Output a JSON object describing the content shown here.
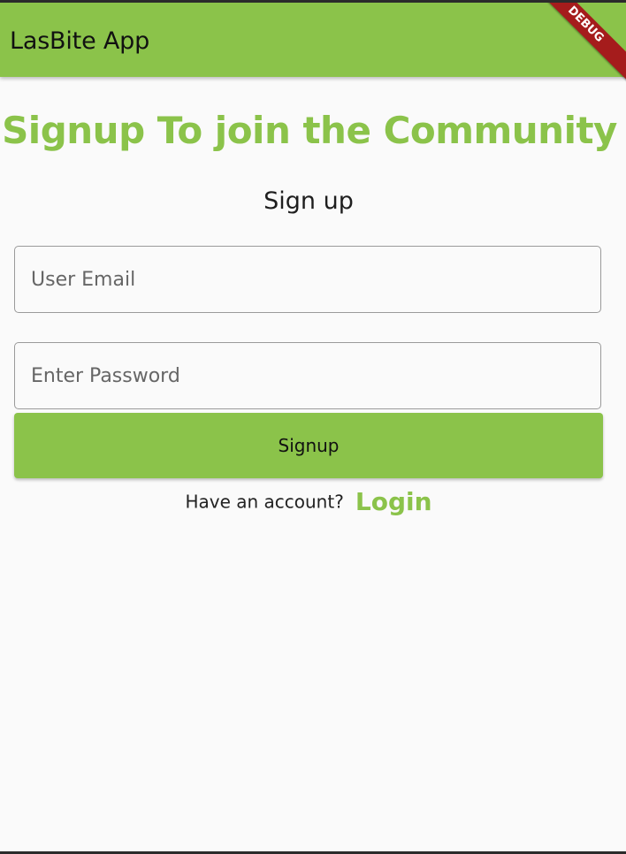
{
  "appbar": {
    "title": "LasBite App",
    "debug_label": "DEBUG",
    "color": "#8bc34a"
  },
  "form": {
    "heading": "Signup To join the Community",
    "subheading": "Sign up",
    "email": {
      "value": "",
      "placeholder": "User Email"
    },
    "password": {
      "value": "",
      "placeholder": "Enter Password"
    },
    "submit_label": "Signup"
  },
  "footer": {
    "prompt": "Have an account?",
    "login_label": "Login"
  },
  "colors": {
    "accent": "#8bc34a",
    "background": "#fafafa",
    "debug_banner": "#a51c1c"
  }
}
